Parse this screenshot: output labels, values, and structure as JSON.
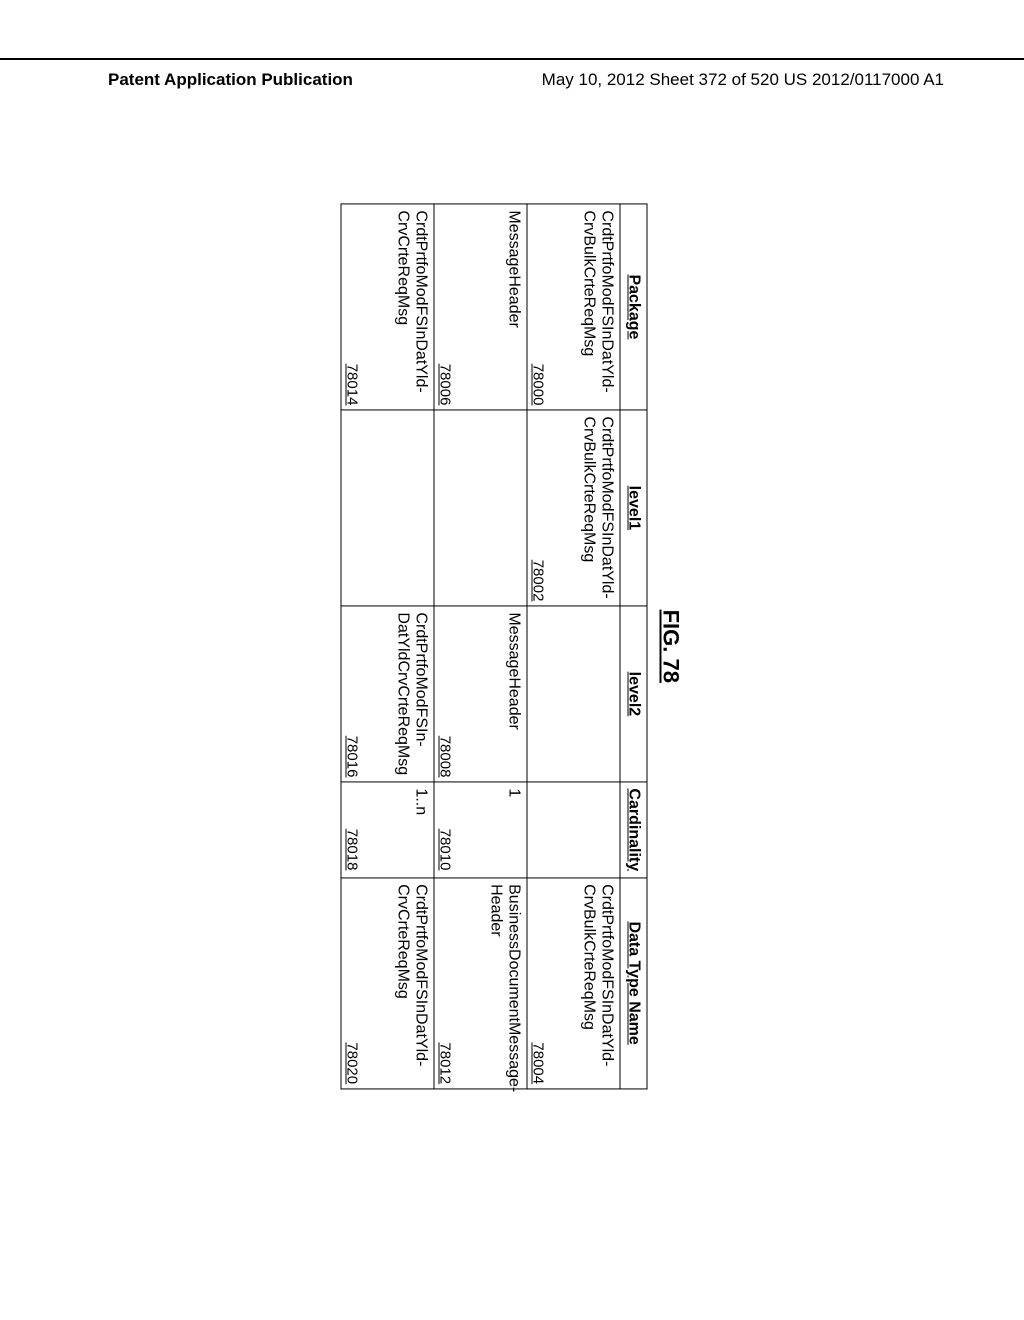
{
  "header": {
    "left": "Patent Application Publication",
    "right": "May 10, 2012  Sheet 372 of 520   US 2012/0117000 A1"
  },
  "figure": {
    "title": "FIG. 78",
    "columns": [
      "Package",
      "level1",
      "level2",
      "Cardinality",
      "Data Type Name"
    ],
    "rows": [
      {
        "package": {
          "text": "CrdtPrtfoModFSInDatYld-CrvBulkCrteReqMsg",
          "ref": "78000"
        },
        "level1": {
          "text": "CrdtPrtfoModFSInDatYld-CrvBulkCrteReqMsg",
          "ref": "78002"
        },
        "level2": {
          "text": "",
          "ref": ""
        },
        "card": {
          "text": "",
          "ref": ""
        },
        "dtn": {
          "text": "CrdtPrtfoModFSInDatYld-CrvBulkCrteReqMsg",
          "ref": "78004"
        }
      },
      {
        "package": {
          "text": "MessageHeader",
          "ref": "78006"
        },
        "level1": {
          "text": "",
          "ref": ""
        },
        "level2": {
          "text": "MessageHeader",
          "ref": "78008"
        },
        "card": {
          "text": "1",
          "ref": "78010"
        },
        "dtn": {
          "text": "BusinessDocumentMessage-Header",
          "ref": "78012"
        }
      },
      {
        "package": {
          "text": "CrdtPrtfoModFSInDatYld-CrvCrteReqMsg",
          "ref": "78014"
        },
        "level1": {
          "text": "",
          "ref": ""
        },
        "level2": {
          "text": "CrdtPrtfoModFSIn-DatYldCrvCrteReqMsg",
          "ref": "78016"
        },
        "card": {
          "text": "1..n",
          "ref": "78018"
        },
        "dtn": {
          "text": "CrdtPrtfoModFSInDatYld-CrvCrteReqMsg",
          "ref": "78020"
        }
      }
    ]
  }
}
